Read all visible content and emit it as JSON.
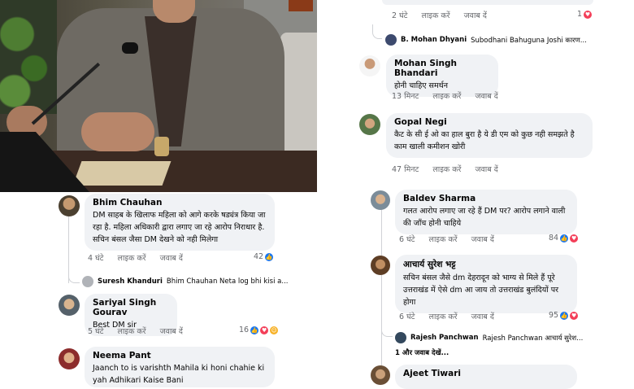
{
  "left_comments": [
    {
      "name": "Bhim Chauhan",
      "text": "DM साहब के खिलाफ महिला को आगे करके षड्यंत्र किया जा रहा है. महिला अधिकारी द्वारा लगाए जा रहे आरोप निराधार है. सचिन बंसल जैसा DM देखने को नही मिलेगा",
      "time": "4 घंटे",
      "like": "लाइक करें",
      "reply": "जवाब दें",
      "count": "42"
    },
    {
      "name": "Sariyal Singh Gourav",
      "text": "Best DM sir",
      "time": "5 घंटे",
      "like": "लाइक करें",
      "reply": "जवाब दें",
      "count": "16"
    },
    {
      "name": "Neema Pant",
      "text": "Jaanch to is varishth Mahila ki honi chahie ki yah Adhikari Kaise Bani"
    }
  ],
  "left_reply": {
    "name": "Suresh Khanduri",
    "text": "Bhim Chauhan Neta log bhi kisi a..."
  },
  "top_right": {
    "time": "2 घंटे",
    "like": "लाइक करें",
    "reply": "जवाब दें",
    "count": "1"
  },
  "top_reply": {
    "name": "B. Mohan Dhyani",
    "text": "Subodhani Bahuguna Joshi कारण..."
  },
  "right_comments": [
    {
      "name": "Mohan Singh Bhandari",
      "text": "होनी चाहिए समर्थन",
      "time": "13 मिनट",
      "like": "लाइक करें",
      "reply": "जवाब दें"
    },
    {
      "name": "Gopal Negi",
      "text": "कैट के सी ई ओ का हाल बुरा है ये डी एम को कुछ नही समझते है काम खाली कमीशन खोरी",
      "time": "47 मिनट",
      "like": "लाइक करें",
      "reply": "जवाब दें"
    },
    {
      "name": "Baldev Sharma",
      "text": "गलत आरोप लगाए जा रहे हैं DM पर? आरोप लगाने वाली की जाँच होनी चाहिये",
      "time": "6 घंटे",
      "like": "लाइक करें",
      "reply": "जवाब दें",
      "count": "84"
    },
    {
      "name": "आचार्य सुरेश भट्ट",
      "text": "सचिन बंसल जैसे dm देहरादून को भाग्य से मिले हैं पूरे उत्तराखंड में ऐसे dm आ जाय तो उत्तराखंड बुलंदियों पर होगा",
      "time": "6 घंटे",
      "like": "लाइक करें",
      "reply": "जवाब दें",
      "count": "95"
    },
    {
      "name": "Ajeet Tiwari"
    }
  ],
  "right_reply": {
    "name": "Rajesh Panchwan",
    "text": "Rajesh Panchwan आचार्य सुरेश..."
  },
  "more_replies": "1 और जवाब देखें...",
  "colors": {
    "like": "#1877f2",
    "love": "#f33e58",
    "bubble": "#f0f2f5"
  }
}
